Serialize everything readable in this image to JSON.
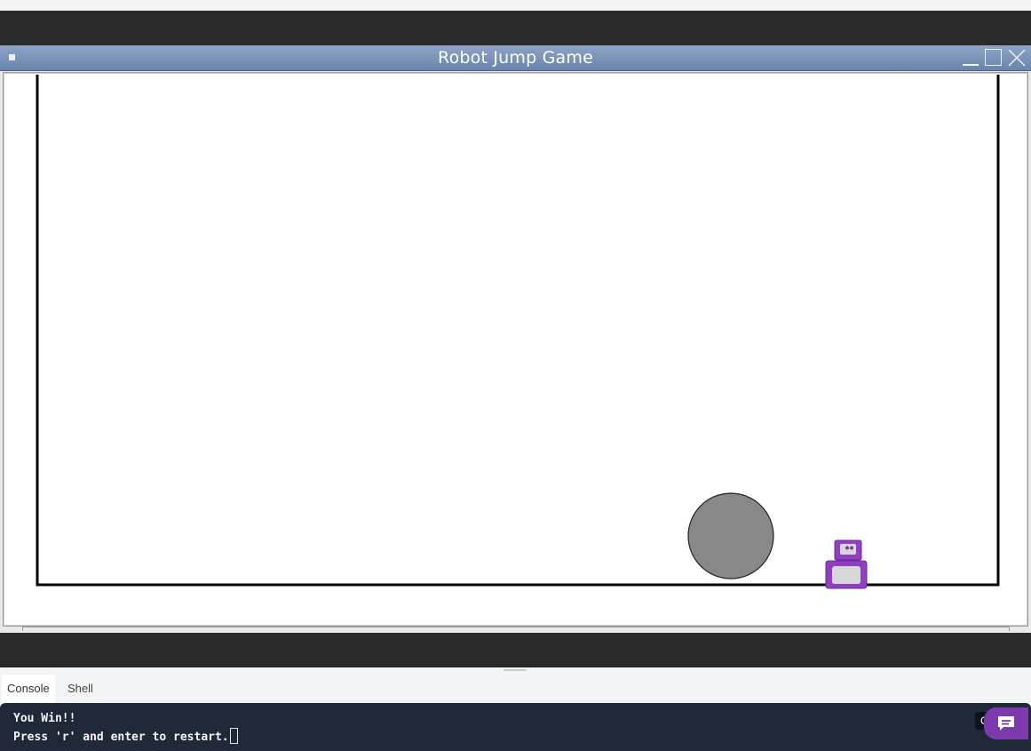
{
  "window": {
    "title": "Robot Jump Game"
  },
  "console_tabs": [
    {
      "label": "Console",
      "active": true
    },
    {
      "label": "Shell",
      "active": false
    }
  ],
  "console": {
    "lines": [
      "You Win!!",
      "Press 'r' and enter to restart."
    ],
    "clear_button_label": "C"
  },
  "colors": {
    "ball": "#888888",
    "robot": "#8f3fc0",
    "robot_panel": "#d7d7d7",
    "chat_button": "#7c3aad",
    "console_bg": "#1f2937"
  },
  "icons": {
    "window_menu": "window-menu-icon",
    "minimize": "minimize-icon",
    "maximize": "maximize-icon",
    "close": "close-icon",
    "chat": "chat-icon"
  }
}
